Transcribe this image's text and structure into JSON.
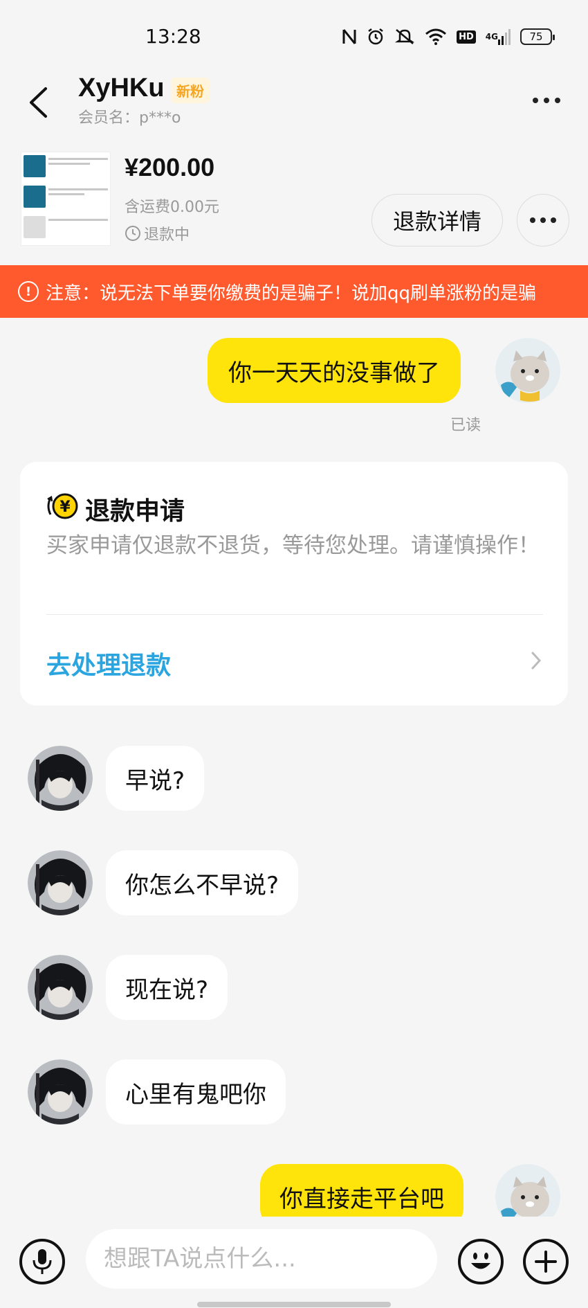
{
  "status_bar": {
    "time": "13:28",
    "battery": "75",
    "network": "4G",
    "hd": "HD"
  },
  "header": {
    "name": "XyHKu",
    "badge": "新粉",
    "member": "会员名：p***o"
  },
  "order": {
    "price": "¥200.00",
    "shipping": "含运费0.00元",
    "status": "退款中",
    "detail_button": "退款详情"
  },
  "warning": {
    "text": "注意：说无法下单要你缴费的是骗子！说加qq刷单涨粉的是骗"
  },
  "chat": {
    "msg1": "你一天天的没事做了",
    "read_label": "已读",
    "refund_card": {
      "title": "退款申请",
      "desc": "买家申请仅退款不退货，等待您处理。请谨慎操作！",
      "action": "去处理退款"
    },
    "msg2": "早说?",
    "msg3": "你怎么不早说?",
    "msg4": "现在说?",
    "msg5": "心里有鬼吧你",
    "msg6": "你直接走平台吧"
  },
  "input": {
    "placeholder": "想跟TA说点什么..."
  },
  "colors": {
    "accent_yellow": "#ffe40b",
    "warning_orange": "#ff5a2e",
    "link_blue": "#2aa5e0",
    "badge_gold": "#f5a623"
  }
}
